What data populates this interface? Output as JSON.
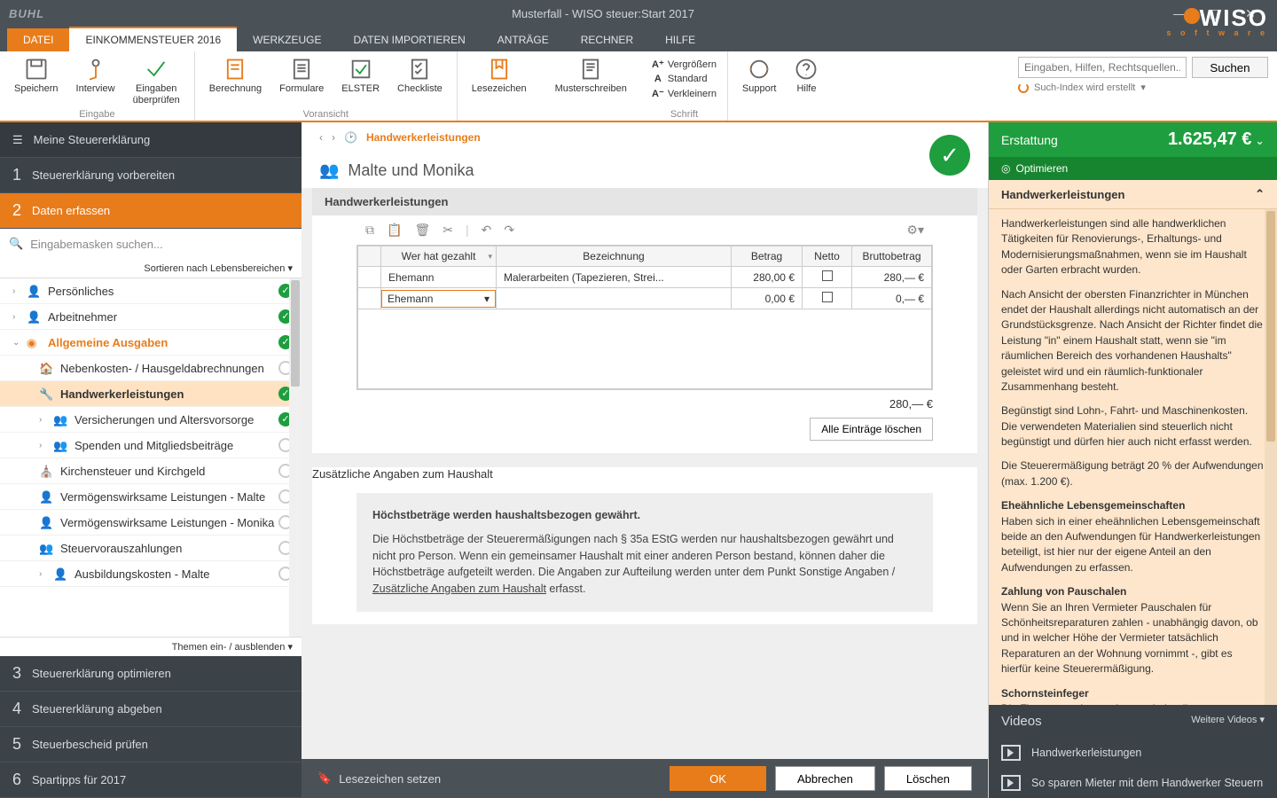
{
  "window": {
    "brand": "BUHL",
    "title": "Musterfall - WISO steuer:Start 2017",
    "logo_main": "WISO",
    "logo_sub": "s o f t w a r e"
  },
  "menutabs": {
    "file": "DATEI",
    "main": "EINKOMMENSTEUER 2016",
    "tools": "WERKZEUGE",
    "import": "DATEN IMPORTIEREN",
    "antraege": "ANTRÄGE",
    "rechner": "RECHNER",
    "hilfe": "HILFE"
  },
  "ribbon": {
    "save": "Speichern",
    "interview": "Interview",
    "check": "Eingaben\nüberprüfen",
    "grp_eingabe": "Eingabe",
    "calc": "Berechnung",
    "forms": "Formulare",
    "elster": "ELSTER",
    "checklist": "Checkliste",
    "grp_vor": "Voransicht",
    "bookmarks": "Lesezeichen",
    "letters": "Musterschreiben",
    "zoom_in": "Vergrößern",
    "zoom_std": "Standard",
    "zoom_out": "Verkleinern",
    "grp_font": "Schrift",
    "support": "Support",
    "help": "Hilfe",
    "search_ph": "Eingaben, Hilfen, Rechtsquellen...",
    "search_btn": "Suchen",
    "index_msg": "Such-Index wird erstellt"
  },
  "leftnav": {
    "header": "Meine Steuererklärung",
    "step1": "Steuererklärung vorbereiten",
    "step2": "Daten erfassen",
    "search_ph": "Eingabemasken suchen...",
    "sort": "Sortieren nach Lebensbereichen ▾",
    "themes": "Themen ein- / ausblenden ▾",
    "tree": {
      "pers": "Persönliches",
      "arbeit": "Arbeitnehmer",
      "allg": "Allgemeine Ausgaben",
      "neben": "Nebenkosten- / Hausgeldabrechnungen",
      "handwerk": "Handwerkerleistungen",
      "versich": "Versicherungen und Altersvorsorge",
      "spenden": "Spenden und Mitgliedsbeiträge",
      "kirchen": "Kirchensteuer und Kirchgeld",
      "vwl_malte": "Vermögenswirksame Leistungen - Malte",
      "vwl_monika": "Vermögenswirksame Leistungen - Monika",
      "vorausz": "Steuervorauszahlungen",
      "ausbild": "Ausbildungskosten - Malte"
    },
    "step3": "Steuererklärung optimieren",
    "step4": "Steuererklärung abgeben",
    "step5": "Steuerbescheid prüfen",
    "step6": "Spartipps für 2017"
  },
  "center": {
    "crumb_cur": "Handwerkerleistungen",
    "names": "Malte und Monika",
    "panel_title": "Handwerkerleistungen",
    "grid": {
      "col_wer": "Wer hat gezahlt",
      "col_bez": "Bezeichnung",
      "col_betrag": "Betrag",
      "col_netto": "Netto",
      "col_brutto": "Bruttobetrag",
      "rows": [
        {
          "wer": "Ehemann",
          "bez": "Malerarbeiten (Tapezieren, Strei...",
          "betrag": "280,00 €",
          "brutto": "280,— €"
        },
        {
          "wer": "Ehemann",
          "bez": "",
          "betrag": "0,00 €",
          "brutto": "0,— €"
        }
      ],
      "total": "280,— €",
      "del_btn": "Alle Einträge löschen"
    },
    "panel2_title": "Zusätzliche Angaben zum Haushalt",
    "info_title": "Höchstbeträge werden haushaltsbezogen gewährt.",
    "info_text": "Die Höchstbeträge der Steuerermäßigungen nach § 35a EStG werden nur haushaltsbezogen gewährt und nicht pro Person. Wenn ein gemeinsamer Haushalt mit einer anderen Person bestand, können daher die Höchstbeträge aufgeteilt werden. Die Angaben zur Aufteilung werden unter dem Punkt Sonstige Angaben / ",
    "info_link": "Zusätzliche Angaben zum Haushalt",
    "info_tail": " erfasst.",
    "footer": {
      "bookmark": "Lesezeichen setzen",
      "ok": "OK",
      "cancel": "Abbrechen",
      "delete": "Löschen"
    }
  },
  "right": {
    "refund_lbl": "Erstattung",
    "refund_val": "1.625,47 €",
    "optimize": "Optimieren",
    "help_title": "Handwerkerleistungen",
    "p1": "Handwerkerleistungen sind alle handwerklichen Tätigkeiten für Renovierungs-, Erhaltungs- und Modernisierungsmaßnahmen, wenn sie im Haushalt oder Garten erbracht wurden.",
    "p2": "Nach Ansicht der obersten Finanzrichter in München endet der Haushalt allerdings nicht automatisch an der Grundstücksgrenze. Nach Ansicht der Richter findet die Leistung \"in\" einem Haushalt statt, wenn sie \"im räumlichen Bereich des vorhandenen Haushalts\" geleistet wird und ein räumlich-funktionaler Zusammenhang besteht.",
    "p3": "Begünstigt sind Lohn-, Fahrt- und Maschinenkosten. Die verwendeten Materialien sind steuerlich nicht begünstigt und dürfen hier auch nicht erfasst werden.",
    "p4": "Die Steuerermäßigung beträgt 20 % der Aufwendungen (max. 1.200 €).",
    "h_ehe": "Eheähnliche Lebensgemeinschaften",
    "p5": "Haben sich in einer eheähnlichen Lebensgemeinschaft beide an den Aufwendungen für Handwerkerleistungen beteiligt, ist hier nur der eigene Anteil an den Aufwendungen zu erfassen.",
    "h_pausch": "Zahlung von Pauschalen",
    "p6": "Wenn Sie an Ihren Vermieter Pauschalen für Schönheitsreparaturen zahlen - unabhängig davon, ob und in welcher Höhe der Vermieter tatsächlich Reparaturen an der Wohnung vornimmt -, gibt es hierfür keine Steuerermäßigung.",
    "h_schorn": "Schornsteinfeger",
    "p7": "Die Finanzverwaltung erkennt wieder die gesamte Rechnung Ihres Schornsteinfegers an. Eine Aufteilung ist nicht mehr erforderlich. Die Leistungen für Mess- und Überprüfarbeiten, Feuerstättenschau, Reinigungs- und Kehrarbeiten sowie sonstige Handwerkerleistungen können Sie ansetzen",
    "videos_title": "Videos",
    "videos_more": "Weitere Videos ▾",
    "video1": "Handwerkerleistungen",
    "video2": "So sparen Mieter mit dem Handwerker Steuern"
  }
}
